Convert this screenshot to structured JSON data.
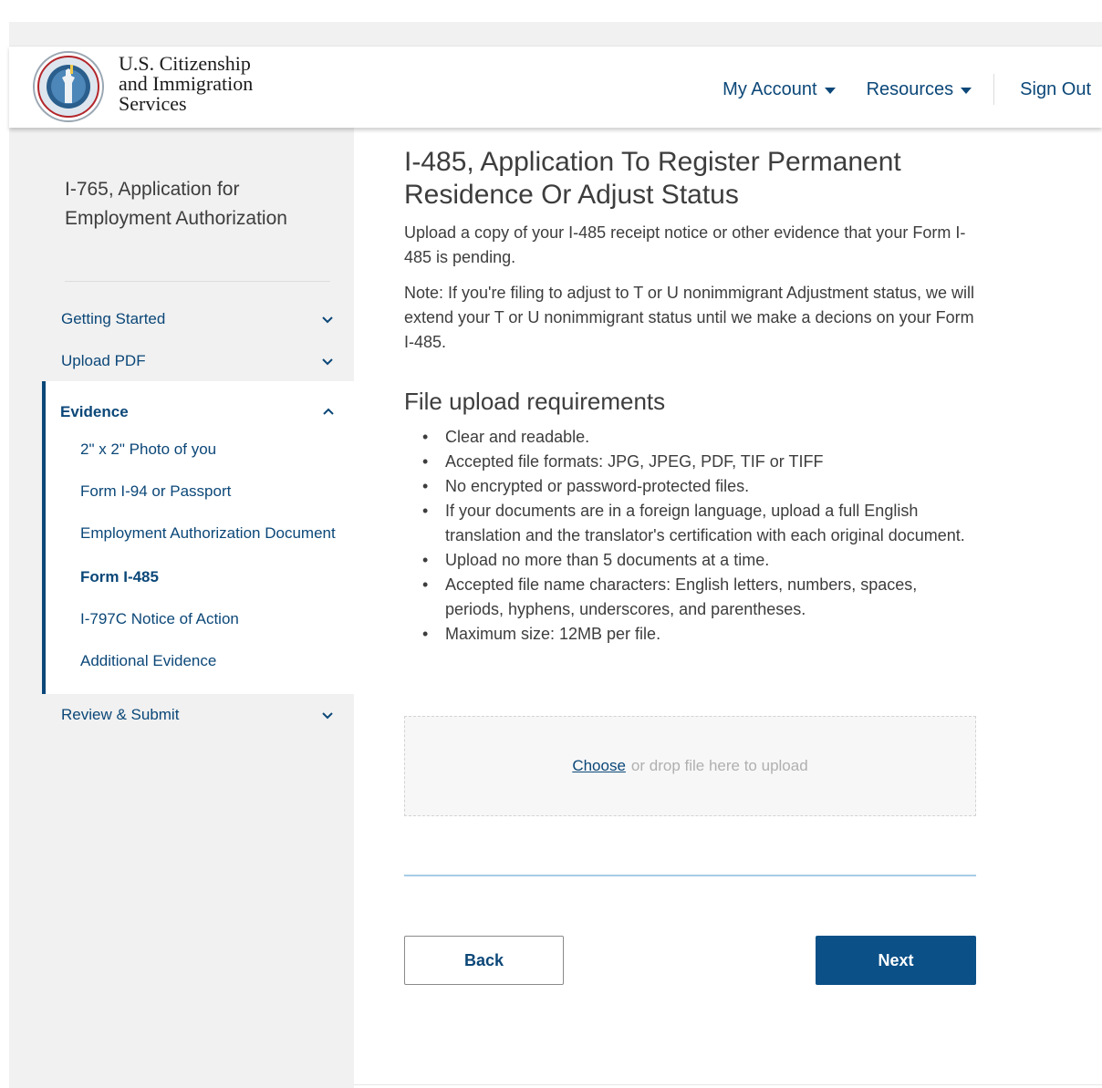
{
  "header": {
    "agency_lines": [
      "U.S. Citizenship",
      "and Immigration",
      "Services"
    ],
    "nav": {
      "my_account": "My Account",
      "resources": "Resources",
      "sign_out": "Sign Out"
    },
    "logo_icon": "uscis-seal-icon"
  },
  "sidebar": {
    "title": "I-765, Application for Employment Authorization",
    "sections": {
      "getting_started": "Getting Started",
      "upload_pdf": "Upload PDF",
      "evidence": "Evidence",
      "review_submit": "Review & Submit"
    },
    "evidence_items": [
      "2\" x 2\" Photo of you",
      "Form I-94 or Passport",
      "Employment Authorization Document",
      "Form I-485",
      "I-797C Notice of Action",
      "Additional Evidence"
    ],
    "active_item": "Form I-485"
  },
  "main": {
    "title": "I-485, Application To Register Permanent Residence Or Adjust Status",
    "description": "Upload a copy of your I-485 receipt notice or other evidence that your Form I-485 is pending.",
    "note": "Note: If you're filing to adjust to T or U nonimmigrant Adjustment status, we will extend your T or U nonimmigrant status until we make a decions on your Form I-485.",
    "requirements_heading": "File upload requirements",
    "requirements": [
      "Clear and readable.",
      "Accepted file formats: JPG, JPEG, PDF, TIF or TIFF",
      "No encrypted or password-protected files.",
      "If your documents are in a foreign language, upload a full English translation and the translator's certification with each original document.",
      "Upload no more than 5 documents at a time.",
      "Accepted file name characters: English letters, numbers, spaces, periods, hyphens, underscores, and parentheses.",
      "Maximum size: 12MB per file."
    ],
    "upload": {
      "choose_label": "Choose",
      "drop_text": "or drop file here to upload"
    },
    "buttons": {
      "back": "Back",
      "next": "Next"
    }
  },
  "colors": {
    "brand_blue": "#0b4778",
    "button_blue": "#0b5087",
    "sidebar_bg": "#f1f1f1"
  }
}
